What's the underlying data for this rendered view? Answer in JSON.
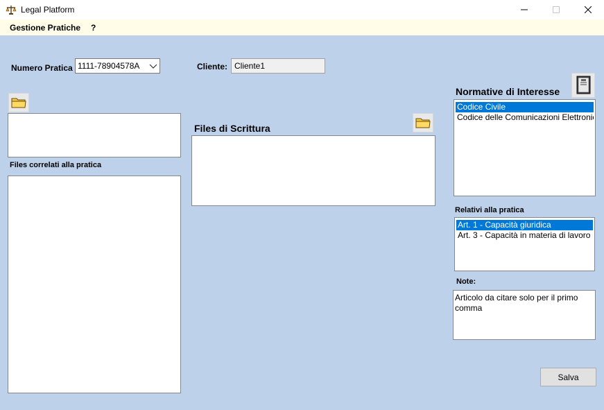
{
  "window": {
    "title": "Legal Platform",
    "icon": "scales-icon",
    "controls": [
      "minimize-icon",
      "maximize-icon",
      "close-icon"
    ]
  },
  "menu": {
    "items": [
      "Gestione Pratiche",
      "?"
    ]
  },
  "form": {
    "numero_pratica_label": "Numero Pratica",
    "numero_pratica_value": "1111-78904578A",
    "cliente_label": "Cliente:",
    "cliente_value": "Cliente1",
    "files_correlati_label": "Files correlati alla pratica",
    "files_scrittura_label": "Files di Scrittura",
    "normative_label": "Normative di Interesse",
    "normative_items": [
      "Codice Civile",
      "Codice delle Comunicazioni Elettroniche"
    ],
    "normative_selected_index": 0,
    "relativi_label": "Relativi alla pratica",
    "relativi_items": [
      "Art. 1 - Capacità giuridica",
      "Art. 3 - Capacità in materia di lavoro"
    ],
    "relativi_selected_index": 0,
    "note_label": "Note:",
    "note_value": "Articolo da citare solo per il primo comma",
    "save_label": "Salva"
  },
  "icons": {
    "folder": "folder-icon",
    "book": "book-icon",
    "dropdown": "chevron-down-icon"
  },
  "colors": {
    "background": "#bdd1ea",
    "menubar": "#fffce8",
    "selection": "#0078d7"
  }
}
